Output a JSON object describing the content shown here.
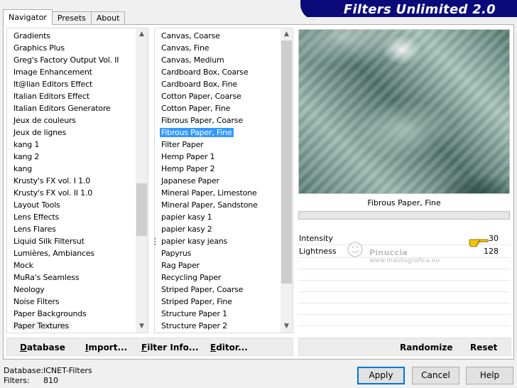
{
  "tabs": [
    {
      "label": "Navigator",
      "active": true
    },
    {
      "label": "Presets",
      "active": false
    },
    {
      "label": "About",
      "active": false
    }
  ],
  "banner": {
    "title": "Filters Unlimited 2.0"
  },
  "categories": {
    "items": [
      "Gradients",
      "Graphics Plus",
      "Greg's Factory Output Vol. II",
      "Image Enhancement",
      "It@lian Editors Effect",
      "Italian Editors Effect",
      "Italian Editors Generatore",
      "Jeux de couleurs",
      "Jeux de lignes",
      "kang 1",
      "kang 2",
      "kang",
      "Krusty's FX vol. I 1.0",
      "Krusty's FX vol. II 1.0",
      "Layout Tools",
      "Lens Effects",
      "Lens Flares",
      "Liquid Silk Filtersut",
      "Lumières, Ambiances",
      "Mock",
      "MuRa's Seamless",
      "Neology",
      "Noise Filters",
      "Paper Backgrounds",
      "Paper Textures"
    ],
    "selected_index": 24
  },
  "filters": {
    "items": [
      "Canvas, Coarse",
      "Canvas, Fine",
      "Canvas, Medium",
      "Cardboard Box, Coarse",
      "Cardboard Box, Fine",
      "Cotton Paper, Coarse",
      "Cotton Paper, Fine",
      "Fibrous Paper, Coarse",
      "Fibrous Paper, Fine",
      "Filter Paper",
      "Hemp Paper 1",
      "Hemp Paper 2",
      "Japanese Paper",
      "Mineral Paper, Limestone",
      "Mineral Paper, Sandstone",
      "papier kasy 1",
      "papier kasy 2",
      "papier kasy jeans",
      "Papyrus",
      "Rag Paper",
      "Recycling Paper",
      "Striped Paper, Coarse",
      "Striped Paper, Fine",
      "Structure Paper 1",
      "Structure Paper 2"
    ],
    "selected_index": 8,
    "marked_index": 17
  },
  "preview": {
    "label": "Fibrous Paper, Fine"
  },
  "params": [
    {
      "name": "Intensity",
      "value": "30"
    },
    {
      "name": "Lightness",
      "value": "128"
    }
  ],
  "watermark": {
    "line1": "Pinuccia",
    "line2": "www.maldisgrafica.eu"
  },
  "left_actions": {
    "database": {
      "u": "D",
      "rest": "atabase"
    },
    "import": {
      "u": "I",
      "rest": "mport..."
    },
    "filter_info": {
      "u": "F",
      "rest": "ilter Info..."
    },
    "editor": {
      "u": "E",
      "rest": "ditor..."
    }
  },
  "right_actions": {
    "randomize": "Randomize",
    "reset": "Reset"
  },
  "footer": {
    "database_label": "Database:",
    "database_value": "ICNET-Filters",
    "filters_label": "Filters:",
    "filters_value": "810"
  },
  "buttons": {
    "apply": "Apply",
    "cancel": "Cancel",
    "help": "Help"
  },
  "colors": {
    "selection": "#3399ff",
    "banner": "#0a0a7a",
    "default_button_border": "#0078d7"
  }
}
